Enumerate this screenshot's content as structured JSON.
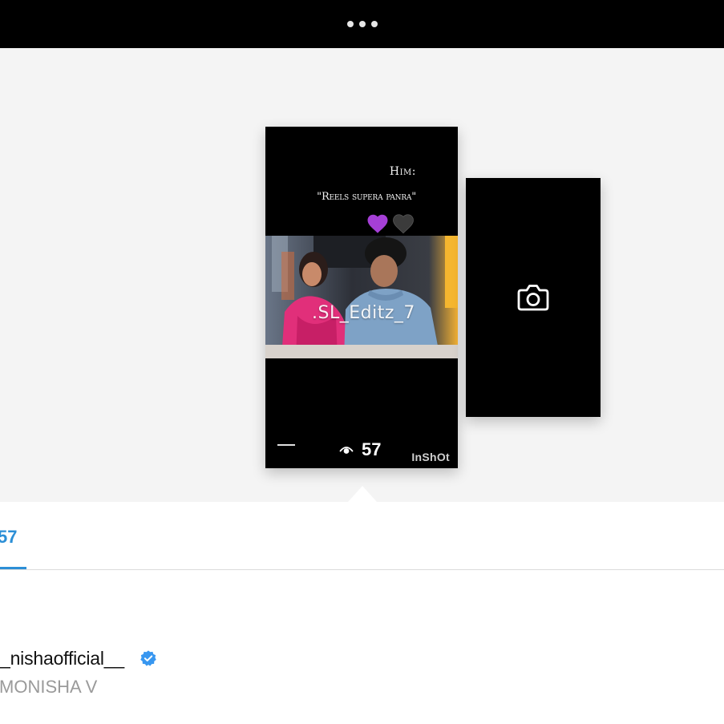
{
  "story": {
    "caption_line1": "Him:",
    "caption_line2": "\"Reels supera panra\"",
    "watermark": ".SL_Editz_7",
    "app_watermark": "InShOt",
    "view_count": "57"
  },
  "viewers_tab": {
    "count": "57"
  },
  "viewer": {
    "username": "_nishaofficial__",
    "full_name": "MONISHA V",
    "verified": true
  },
  "colors": {
    "accent": "#2c8fd6",
    "heart_purple": "#a53fd6",
    "verified_blue": "#3897f0"
  }
}
